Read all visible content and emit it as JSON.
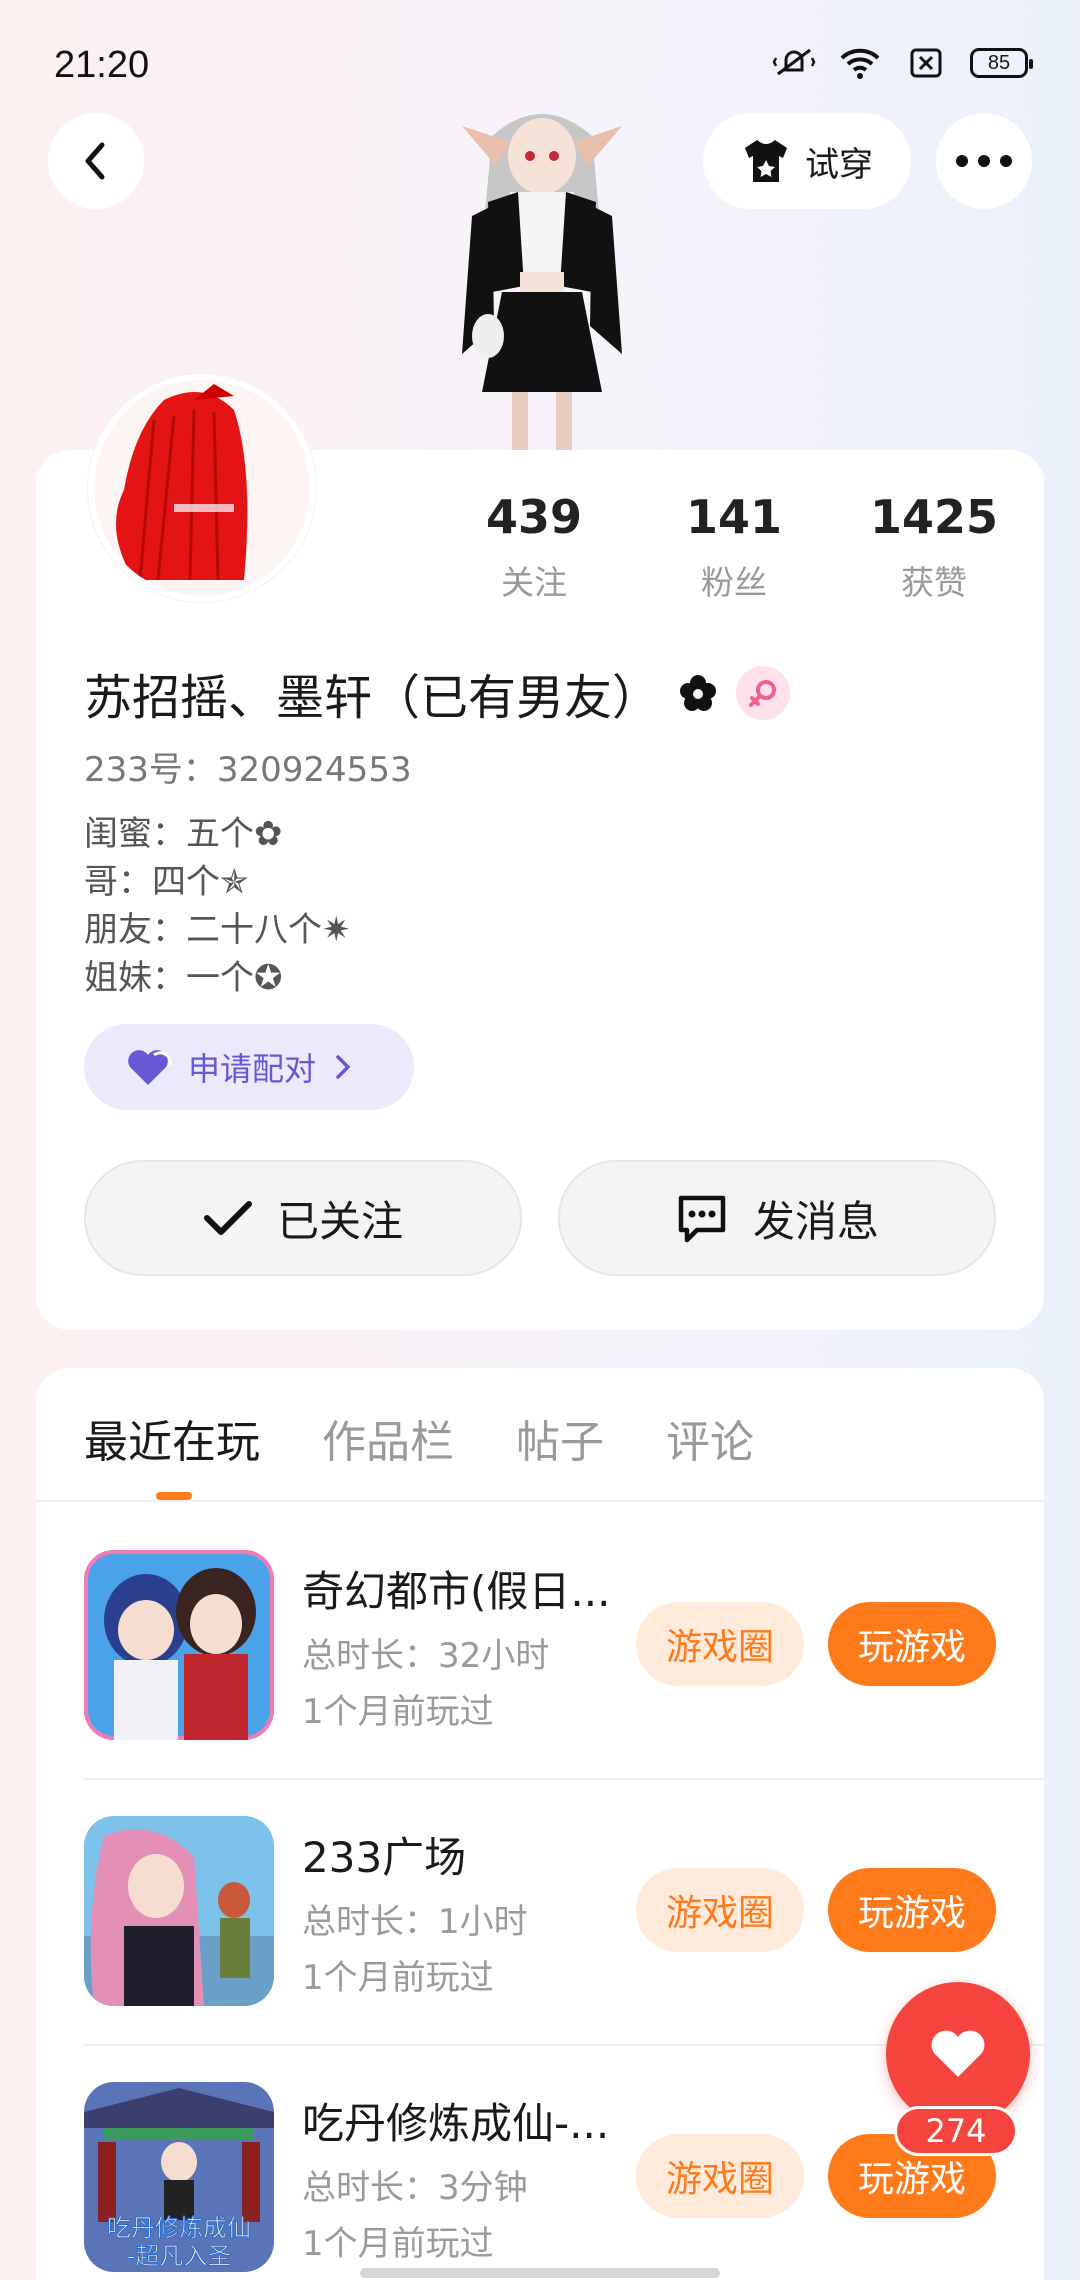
{
  "status_bar": {
    "time": "21:20",
    "battery": "85"
  },
  "header": {
    "tryon_label": "试穿"
  },
  "stats": [
    {
      "value": "439",
      "label": "关注"
    },
    {
      "value": "141",
      "label": "粉丝"
    },
    {
      "value": "1425",
      "label": "获赞"
    }
  ],
  "profile": {
    "name": "苏招摇、墨轩（已有男友）",
    "id_text": "233号：320924553",
    "bio": [
      "闺蜜：五个✿",
      "哥：四个✯",
      "朋友：二十八个✷",
      "姐妹：一个✪"
    ]
  },
  "pair_button": {
    "label": "申请配对"
  },
  "actions": {
    "follow_label": "已关注",
    "message_label": "发消息"
  },
  "tabs": [
    {
      "label": "最近在玩",
      "active": true
    },
    {
      "label": "作品栏",
      "active": false
    },
    {
      "label": "帖子",
      "active": false
    },
    {
      "label": "评论",
      "active": false
    }
  ],
  "games": [
    {
      "title": "奇幻都市(假日...",
      "duration": "总时长：32小时",
      "last_played": "1个月前玩过",
      "circle_label": "游戏圈",
      "play_label": "玩游戏"
    },
    {
      "title": "233广场",
      "duration": "总时长：1小时",
      "last_played": "1个月前玩过",
      "circle_label": "游戏圈",
      "play_label": "玩游戏"
    },
    {
      "title": "吃丹修炼成仙-...",
      "duration": "总时长：3分钟",
      "last_played": "1个月前玩过",
      "circle_label": "游戏圈",
      "play_label": "玩游戏",
      "icon_text": [
        "吃丹修炼成仙",
        "-超凡入圣"
      ]
    }
  ],
  "like": {
    "count": "274"
  },
  "colors": {
    "accent": "#ff7a1a",
    "like": "#f4443d",
    "pair": "#6758d6"
  }
}
